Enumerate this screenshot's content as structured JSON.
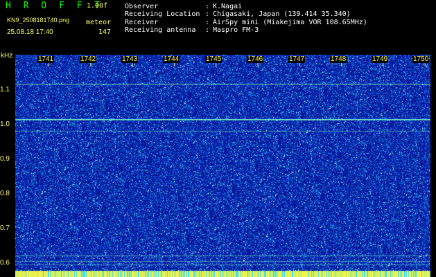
{
  "header": {
    "app_title": "H R O F F T",
    "version": "1.00f",
    "filename": "KN9_2508181740.png",
    "mode": "meteor",
    "datetime": "25.08.18 17:40",
    "count": "147"
  },
  "info": [
    {
      "key": "Observer",
      "value": "K.Nagai"
    },
    {
      "key": "Receiving Location",
      "value": "Chigasaki, Japan (139.414 35.340)"
    },
    {
      "key": "Receiver",
      "value": "AirSpy mini (Miakejima VOR 108.65MHz)"
    },
    {
      "key": "Receiving antenna",
      "value": "Maspro FM-3"
    }
  ],
  "colon": ":",
  "axes": {
    "y_unit": "kHz",
    "y_ticks": [
      "1.1",
      "1.0",
      "0.9",
      "0.8",
      "0.7",
      "0.6"
    ],
    "x_ticks": [
      "1741",
      "1742",
      "1743",
      "1744",
      "1745",
      "1746",
      "1747",
      "1748",
      "1749",
      "1750"
    ]
  },
  "colors": {
    "background": "#000000",
    "spectrum_base": "#0a1aa8",
    "noise_bright": "#22c8ff",
    "signal_line": "#7dffd0",
    "bottom_strip": "#f2f24a",
    "label_yellow": "#ffff66",
    "title_green": "#00ff00"
  }
}
